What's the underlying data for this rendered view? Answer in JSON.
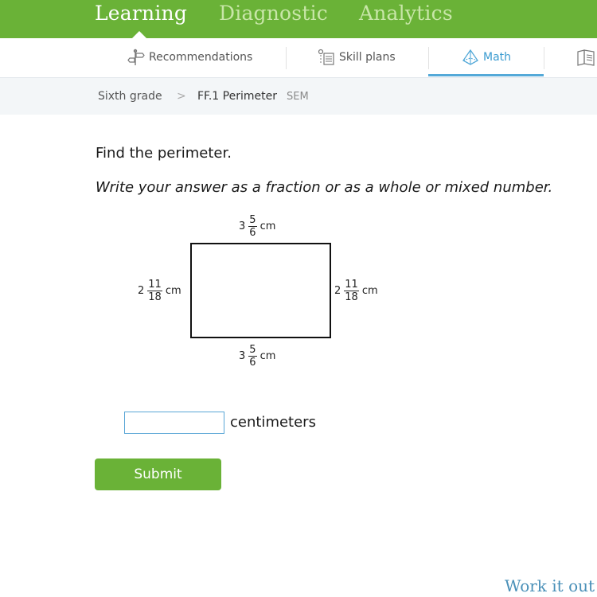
{
  "top_nav": {
    "tabs": [
      {
        "label": "Learning",
        "active": true
      },
      {
        "label": "Diagnostic",
        "active": false
      },
      {
        "label": "Analytics",
        "active": false
      }
    ]
  },
  "sub_nav": {
    "items": [
      {
        "label": "Recommendations",
        "icon": "signpost-icon",
        "active": false
      },
      {
        "label": "Skill plans",
        "icon": "skill-plan-icon",
        "active": false
      },
      {
        "label": "Math",
        "icon": "pyramid-icon",
        "active": true
      },
      {
        "label": "",
        "icon": "book-icon",
        "active": false
      }
    ]
  },
  "breadcrumb": {
    "grade": "Sixth grade",
    "separator": ">",
    "skill": "FF.1 Perimeter",
    "code": "SEM"
  },
  "question": {
    "prompt": "Find the perimeter.",
    "instruction": "Write your answer as a fraction or as a whole or mixed number.",
    "figure": {
      "shape": "rectangle",
      "top": {
        "whole": "3",
        "numerator": "5",
        "denominator": "6",
        "unit": "cm"
      },
      "bottom": {
        "whole": "3",
        "numerator": "5",
        "denominator": "6",
        "unit": "cm"
      },
      "left": {
        "whole": "2",
        "numerator": "11",
        "denominator": "18",
        "unit": "cm"
      },
      "right": {
        "whole": "2",
        "numerator": "11",
        "denominator": "18",
        "unit": "cm"
      }
    },
    "answer": {
      "value": "",
      "placeholder": "",
      "unit": "centimeters"
    },
    "submit_label": "Submit"
  },
  "footer": {
    "work_it_out": "Work it out"
  },
  "colors": {
    "brand_green": "#6ab237",
    "accent_blue": "#54a9d8",
    "link_blue": "#4a90b8"
  }
}
